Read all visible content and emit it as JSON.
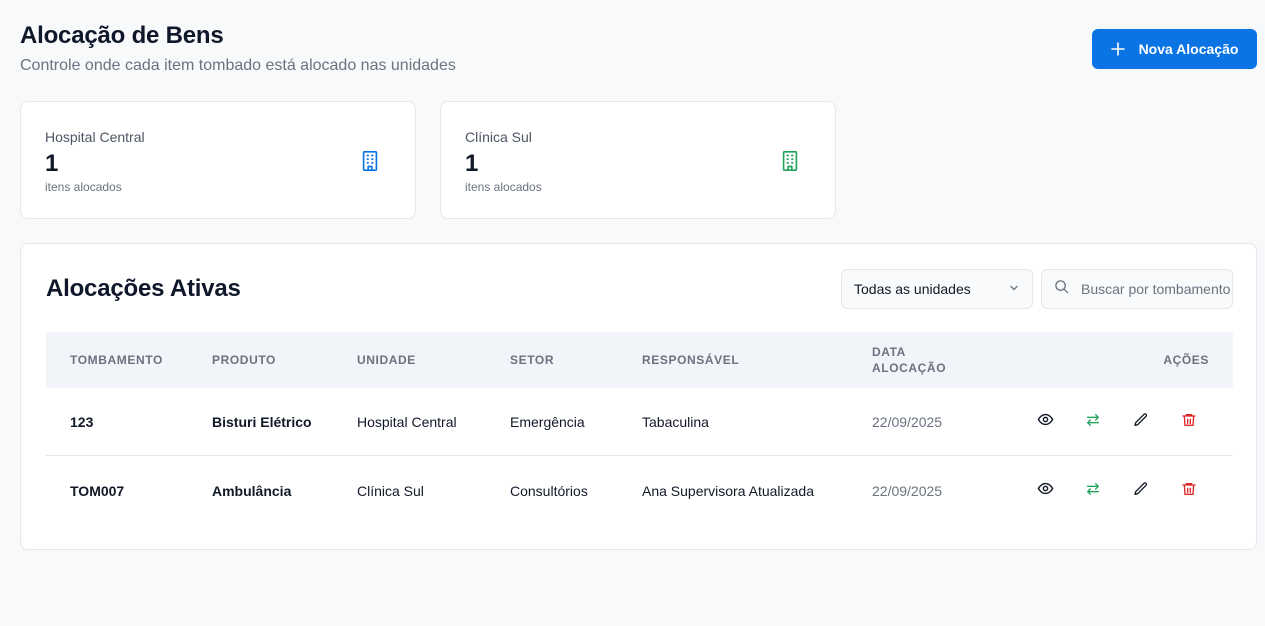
{
  "header": {
    "title": "Alocação de Bens",
    "subtitle": "Controle onde cada item tombado está alocado nas unidades",
    "new_button_label": "Nova Alocação"
  },
  "stats": [
    {
      "name": "Hospital Central",
      "count": "1",
      "caption": "itens alocados",
      "icon": "building-icon",
      "color": "#0b74e5"
    },
    {
      "name": "Clínica Sul",
      "count": "1",
      "caption": "itens alocados",
      "icon": "building-icon",
      "color": "#22a559"
    }
  ],
  "panel": {
    "title": "Alocações Ativas",
    "unit_filter": {
      "selected": "Todas as unidades"
    },
    "search": {
      "placeholder": "Buscar por tombamento"
    }
  },
  "table": {
    "columns": {
      "tombamento": "TOMBAMENTO",
      "produto": "PRODUTO",
      "unidade": "UNIDADE",
      "setor": "SETOR",
      "responsavel": "RESPONSÁVEL",
      "data_line1": "DATA",
      "data_line2": "ALOCAÇÃO",
      "acoes": "AÇÕES"
    },
    "rows": [
      {
        "tombamento": "123",
        "produto": "Bisturi Elétrico",
        "unidade": "Hospital Central",
        "setor": "Emergência",
        "responsavel": "Tabaculina",
        "data": "22/09/2025"
      },
      {
        "tombamento": "TOM007",
        "produto": "Ambulância",
        "unidade": "Clínica Sul",
        "setor": "Consultórios",
        "responsavel": "Ana Supervisora Atualizada",
        "data": "22/09/2025"
      }
    ],
    "action_icons": [
      "eye-icon",
      "transfer-icon",
      "pencil-icon",
      "trash-icon"
    ],
    "action_colors": {
      "view": "#111827",
      "transfer": "#22a559",
      "edit": "#111827",
      "delete": "#dc2626"
    }
  },
  "colors": {
    "accent": "#0b74e5",
    "success": "#22a559",
    "danger": "#dc2626"
  }
}
